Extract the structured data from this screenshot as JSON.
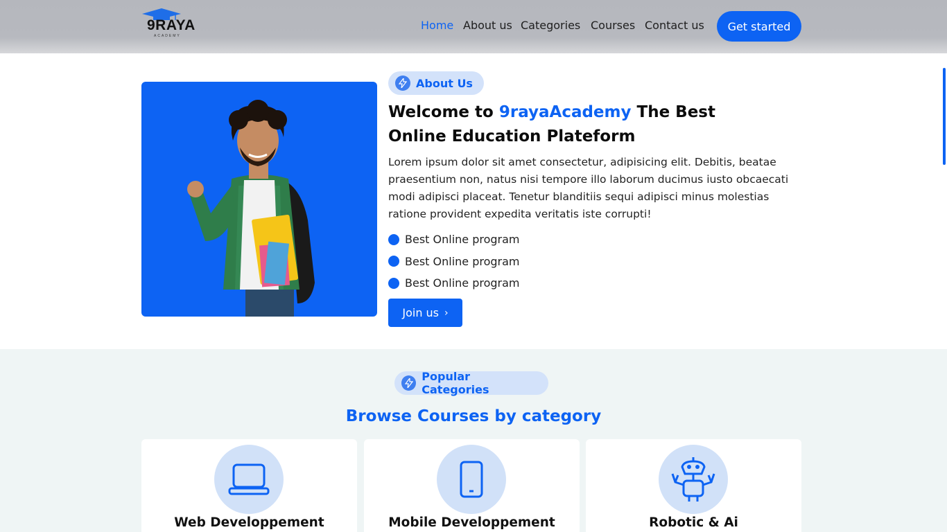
{
  "header": {
    "logo_text": "9RAYA",
    "logo_sub": "ACADEMY",
    "nav": [
      {
        "label": "Home",
        "active": true
      },
      {
        "label": "About us"
      },
      {
        "label": "Categories"
      },
      {
        "label": "Courses"
      },
      {
        "label": "Contact us"
      }
    ],
    "cta": "Get started"
  },
  "about": {
    "badge": "About Us",
    "title_prefix": "Welcome to ",
    "title_highlight": "9rayaAcademy",
    "title_suffix": " The Best Online Education Plateform",
    "text": "Lorem ipsum dolor sit amet consectetur, adipisicing elit. Debitis, beatae praesentium non, natus nisi tempore illo laborum ducimus iusto obcaecati modi adipisci placeat. Tenetur blanditiis sequi adipisci minus molestias ratione provident expedita veritatis iste corrupti!",
    "bullets": [
      "Best Online program",
      "Best Online program",
      "Best Online program"
    ],
    "join_label": "Join us"
  },
  "categories": {
    "badge": "Popular Categories",
    "title": "Browse Courses by category",
    "items": [
      {
        "name": "Web Developpement",
        "icon": "laptop-icon"
      },
      {
        "name": "Mobile Developpement",
        "icon": "smartphone-icon"
      },
      {
        "name": "Robotic & Ai",
        "icon": "robot-icon"
      }
    ]
  },
  "colors": {
    "accent": "#0d63f3",
    "badge_bg": "#d3e2fa",
    "section_bg": "#eff5f5"
  }
}
